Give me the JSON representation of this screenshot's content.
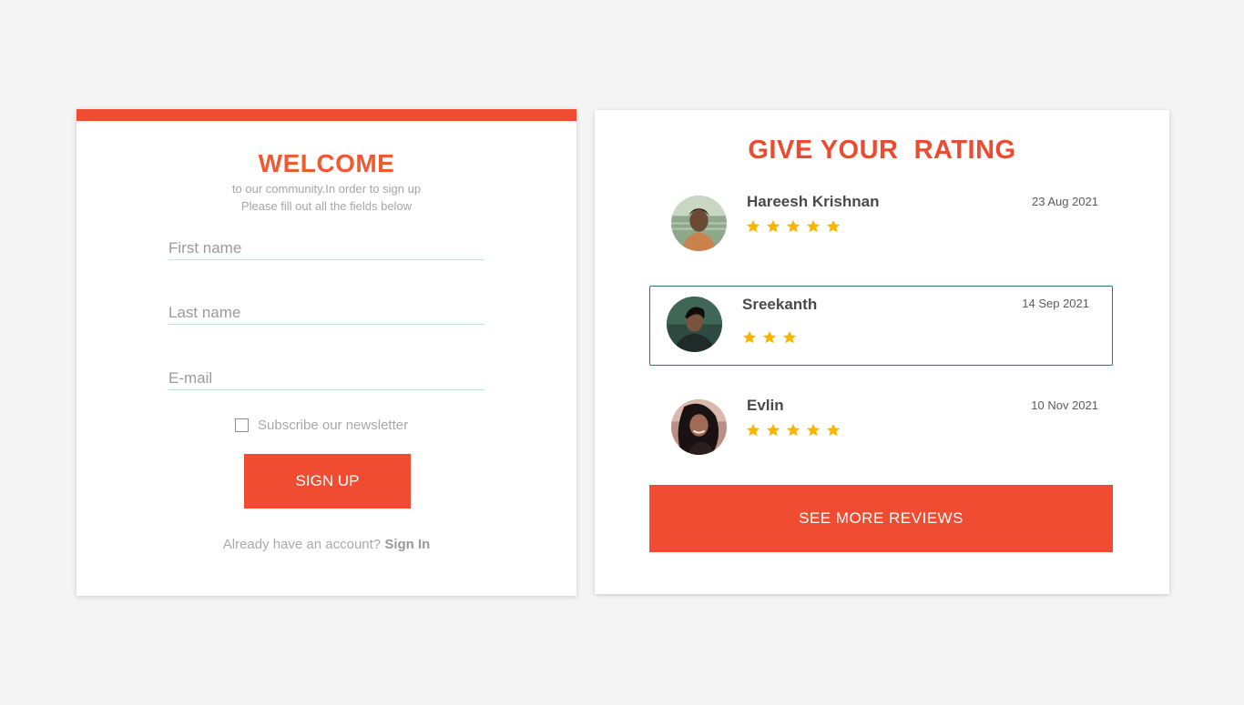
{
  "signup": {
    "title": "WELCOME",
    "subtitle_line1": "to our community.In order to sign up",
    "subtitle_line2": "Please fill out all the fields below",
    "first_name_placeholder": "First name",
    "last_name_placeholder": "Last name",
    "email_placeholder": "E-mail",
    "newsletter_label": "Subscribe our newsletter",
    "newsletter_checked": false,
    "button_label": "SIGN UP",
    "signin_prompt": "Already have an account? ",
    "signin_link": "Sign In"
  },
  "rating": {
    "title": "GIVE YOUR  RATING",
    "reviews": [
      {
        "name": "Hareesh Krishnan",
        "date": "23 Aug 2021",
        "stars": 5
      },
      {
        "name": "Sreekanth",
        "date": "14 Sep 2021",
        "stars": 3
      },
      {
        "name": "Evlin",
        "date": "10 Nov 2021",
        "stars": 5
      }
    ],
    "more_button": "SEE MORE REVIEWS"
  },
  "icons": {
    "star": "star-icon",
    "checkbox": "checkbox-icon",
    "avatar": "avatar"
  },
  "colors": {
    "accent": "#f04c32",
    "title": "#f05a33",
    "star": "#f7b500",
    "highlight_border": "#1e7f66",
    "field_underline": "#bfe3dc"
  }
}
